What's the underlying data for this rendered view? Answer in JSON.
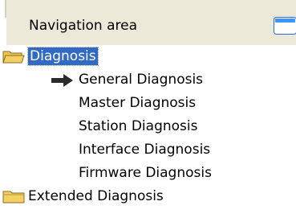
{
  "panel": {
    "title": "Navigation area",
    "title_icon": "window-icon"
  },
  "tree": {
    "root": {
      "label": "Diagnosis",
      "icon": "folder-open-icon",
      "selected": true,
      "children": [
        {
          "label": "General Diagnosis",
          "icon": "arrow-right-icon",
          "current": true
        },
        {
          "label": "Master Diagnosis"
        },
        {
          "label": "Station Diagnosis"
        },
        {
          "label": "Interface Diagnosis"
        },
        {
          "label": "Firmware Diagnosis"
        }
      ]
    },
    "second": {
      "label": "Extended Diagnosis",
      "icon": "folder-closed-icon"
    }
  },
  "colors": {
    "header_bg": "#ece9d8",
    "selection_bg": "#316ac5",
    "folder_yellow": "#f4cf63",
    "icon_blue": "#3d95ff"
  }
}
